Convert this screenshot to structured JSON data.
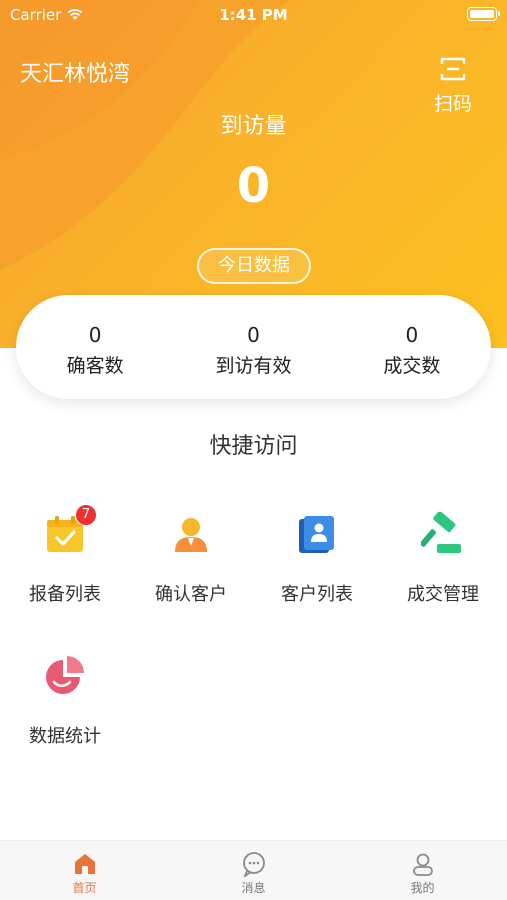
{
  "status_bar": {
    "carrier": "Carrier",
    "time": "1:41 PM"
  },
  "header": {
    "project_name": "天汇林悦湾",
    "scan_label": "扫码",
    "visits_label": "到访量",
    "visits_value": "0",
    "today_button": "今日数据"
  },
  "stats": [
    {
      "value": "0",
      "label": "确客数"
    },
    {
      "value": "0",
      "label": "到访有效"
    },
    {
      "value": "0",
      "label": "成交数"
    }
  ],
  "quick_access": {
    "title": "快捷访问",
    "items": [
      {
        "label": "报备列表",
        "icon": "clipboard-check-icon",
        "badge": "7"
      },
      {
        "label": "确认客户",
        "icon": "person-icon"
      },
      {
        "label": "客户列表",
        "icon": "address-book-icon"
      },
      {
        "label": "成交管理",
        "icon": "gavel-icon"
      },
      {
        "label": "数据统计",
        "icon": "pie-chart-icon"
      }
    ]
  },
  "tabbar": [
    {
      "label": "首页",
      "icon": "home-icon",
      "active": true
    },
    {
      "label": "消息",
      "icon": "message-icon",
      "active": false
    },
    {
      "label": "我的",
      "icon": "user-icon",
      "active": false
    }
  ],
  "colors": {
    "accent": "#f7a12e",
    "accent_light": "#fbc11f",
    "badge": "#ef3030",
    "tab_active": "#e8743b"
  }
}
